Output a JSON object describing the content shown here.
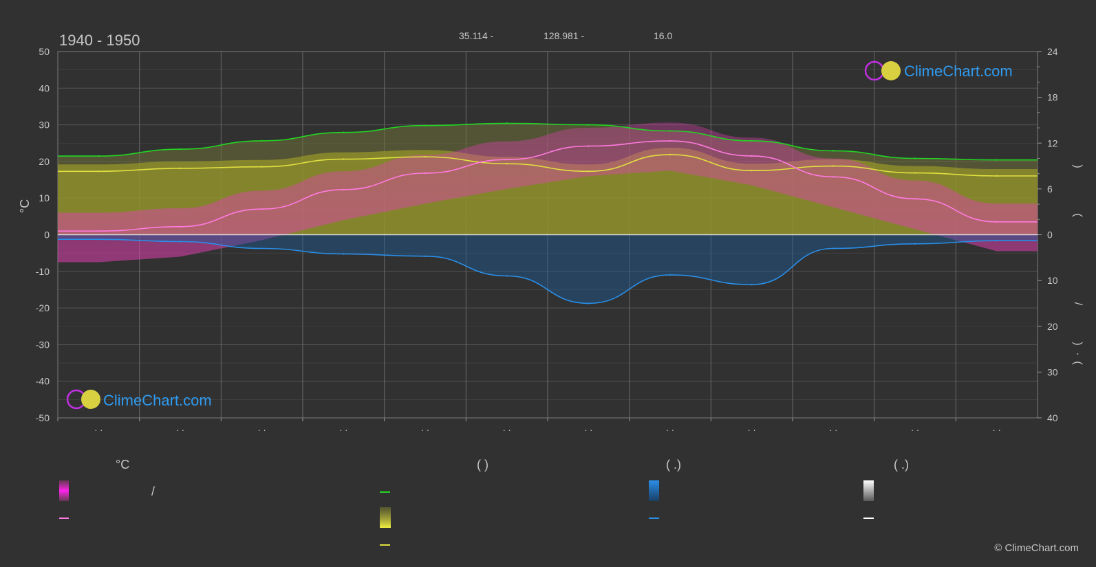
{
  "header": {
    "period": "1940 - 1950",
    "lat": "35.114 -",
    "lon": "128.981 -",
    "elev": "16.0"
  },
  "brand": {
    "name": "ClimeChart.com",
    "copyright": "© ClimeChart.com"
  },
  "axes": {
    "left_unit": "°C",
    "right_labels": [
      ")",
      "(",
      "/",
      ")",
      "·",
      "("
    ],
    "month_ticks": [
      "· ·",
      "· ·",
      "· ·",
      "· ·",
      "· ·",
      "· ·",
      "· ·",
      "· ·",
      "· ·",
      "· ·",
      "· ·",
      "· ·"
    ]
  },
  "legend": {
    "temp_header": "°C",
    "sun_header": "(            )",
    "rain_header": "(     .)",
    "snow_header": "(     .)",
    "slash": "/"
  },
  "colors": {
    "background": "#313131",
    "daylight": "#22d622",
    "sunshine": "#e0e040",
    "sunshine_fill": "#9a9a2a",
    "temp_mean": "#ff7ae0",
    "temp_fill": "#e040b0",
    "rain": "#2a8ee8",
    "rain_fill": "#1c5c94",
    "snow": "#ffffff",
    "grid": "#5a5a5a",
    "brand": "#2f9bf0"
  },
  "chart_data": {
    "type": "line",
    "title": "1940 - 1950",
    "ylabel": "°C",
    "ylim": [
      -50,
      50
    ],
    "y_ticks": [
      50,
      40,
      30,
      20,
      10,
      0,
      -10,
      -20,
      -30,
      -40,
      -50
    ],
    "right_axis_sun": {
      "ylim": [
        0,
        24
      ],
      "ticks": [
        0,
        6,
        12,
        18,
        24
      ]
    },
    "right_axis_rain": {
      "ylim": [
        0,
        40
      ],
      "ticks": [
        10,
        20,
        30,
        40
      ]
    },
    "x": [
      1,
      2,
      3,
      4,
      5,
      6,
      7,
      8,
      9,
      10,
      11,
      12
    ],
    "grid": true,
    "series": [
      {
        "values": [
          1.0,
          2.2,
          7.0,
          12.3,
          16.8,
          20.5,
          24.2,
          25.6,
          21.5,
          15.8,
          9.8,
          3.5
        ],
        "color": "#ff7ae0"
      },
      {
        "values": [
          -0.5,
          1.0,
          5.5,
          11.0,
          15.5,
          19.5,
          23.0,
          24.5,
          20.5,
          14.5,
          8.5,
          2.5
        ],
        "color": "#e040b0"
      },
      {
        "values": [
          10.3,
          11.2,
          12.3,
          13.4,
          14.3,
          14.6,
          14.4,
          13.6,
          12.3,
          11.0,
          10.0,
          9.8
        ],
        "color": "#22d622"
      },
      {
        "values": [
          8.3,
          8.7,
          8.9,
          9.9,
          10.2,
          9.3,
          8.3,
          10.5,
          8.4,
          9.0,
          8.1,
          7.7
        ],
        "color": "#e0e040"
      },
      {
        "values": [
          1.0,
          1.5,
          3.0,
          4.2,
          4.7,
          9.0,
          15.0,
          8.8,
          10.9,
          3.0,
          2.0,
          1.3
        ],
        "color": "#2a8ee8"
      }
    ]
  }
}
